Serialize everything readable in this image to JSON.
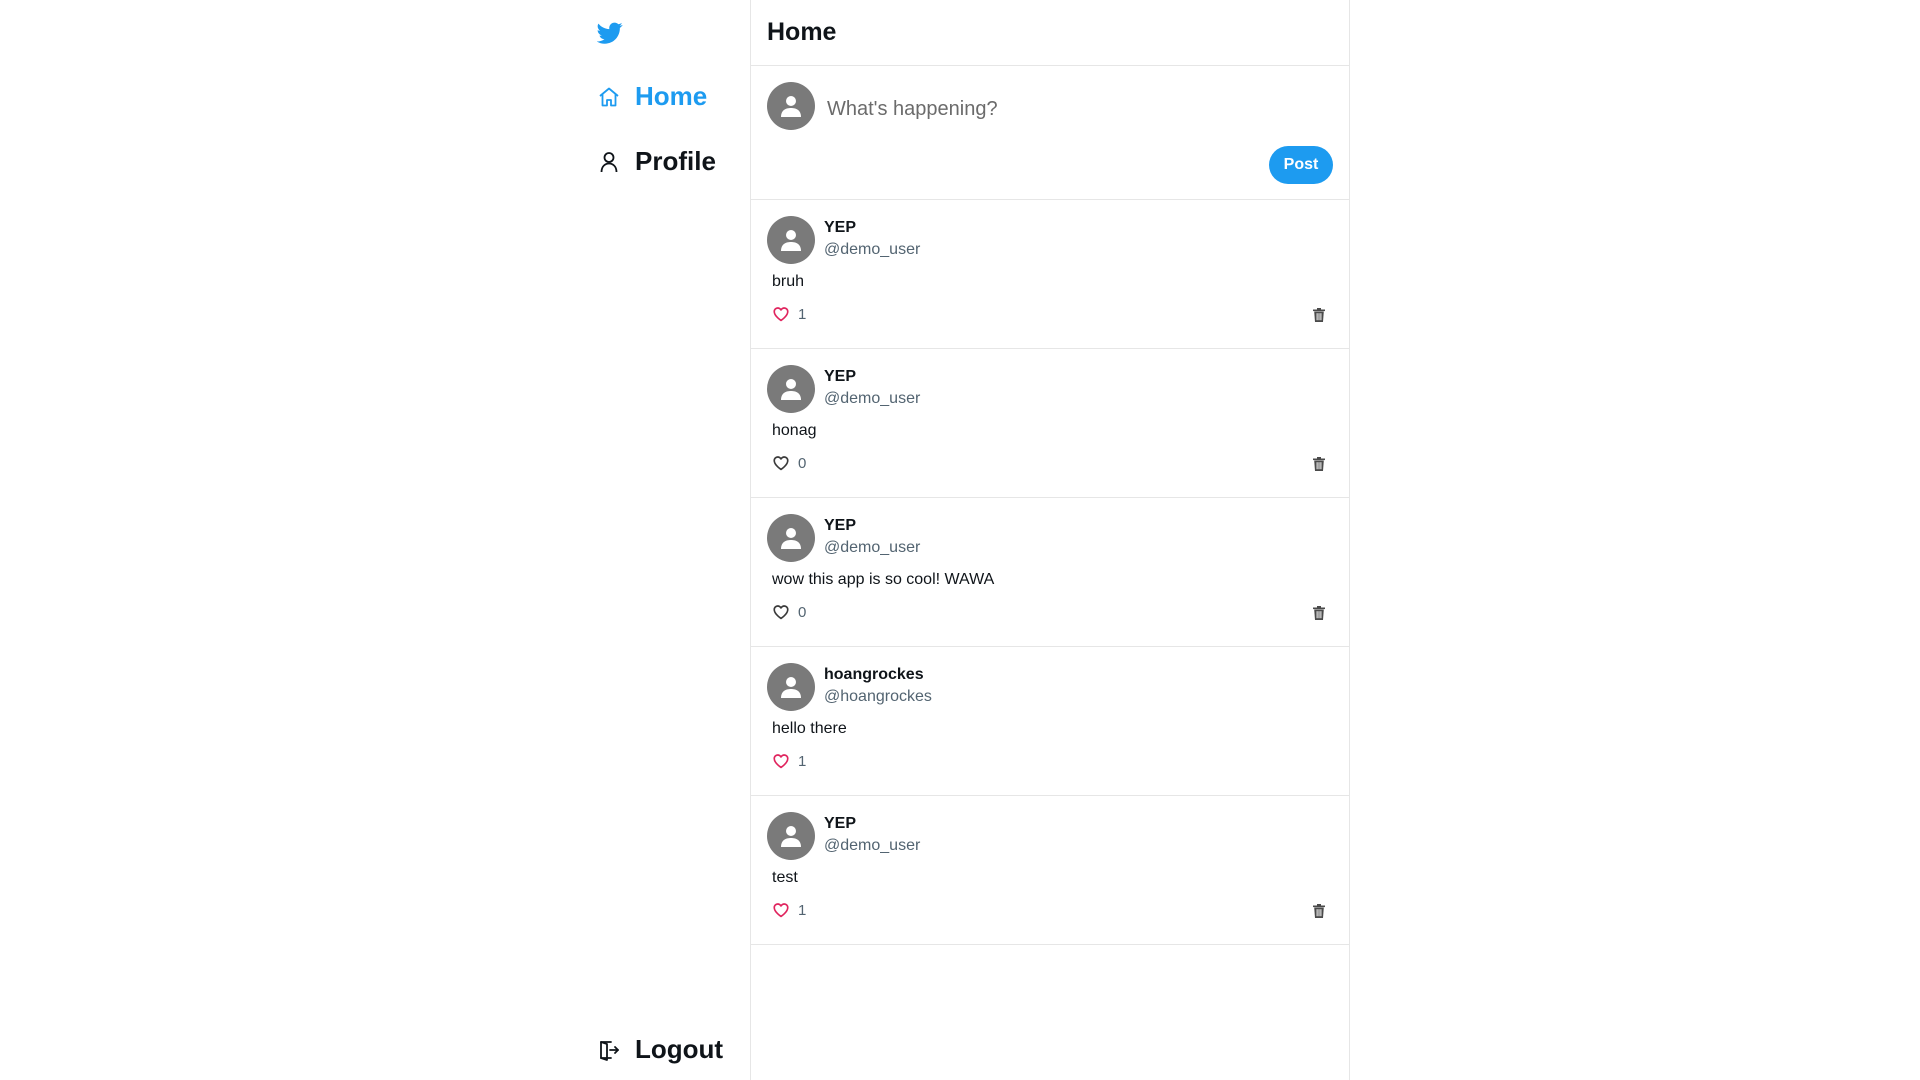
{
  "app": {
    "brand_color": "#1d9bf0",
    "logo_icon": "twitter-bird-icon"
  },
  "sidebar": {
    "items": [
      {
        "label": "Home",
        "icon": "home-icon",
        "active": true
      },
      {
        "label": "Profile",
        "icon": "user-icon",
        "active": false
      }
    ],
    "logout": {
      "label": "Logout",
      "icon": "logout-icon"
    }
  },
  "header": {
    "title": "Home"
  },
  "composer": {
    "placeholder": "What's happening?",
    "post_label": "Post"
  },
  "feed": [
    {
      "name": "YEP",
      "handle": "@demo_user",
      "text": "bruh",
      "likes": "1",
      "liked": true,
      "deletable": true
    },
    {
      "name": "YEP",
      "handle": "@demo_user",
      "text": "honag",
      "likes": "0",
      "liked": false,
      "deletable": true
    },
    {
      "name": "YEP",
      "handle": "@demo_user",
      "text": "wow this app is so cool! WAWA",
      "likes": "0",
      "liked": false,
      "deletable": true
    },
    {
      "name": "hoangrockes",
      "handle": "@hoangrockes",
      "text": "hello there",
      "likes": "1",
      "liked": true,
      "deletable": false
    },
    {
      "name": "YEP",
      "handle": "@demo_user",
      "text": "test",
      "likes": "1",
      "liked": true,
      "deletable": true
    }
  ],
  "colors": {
    "like_active": "#e0245e",
    "text_secondary": "#536471",
    "avatar_bg": "#7a7a7a"
  }
}
